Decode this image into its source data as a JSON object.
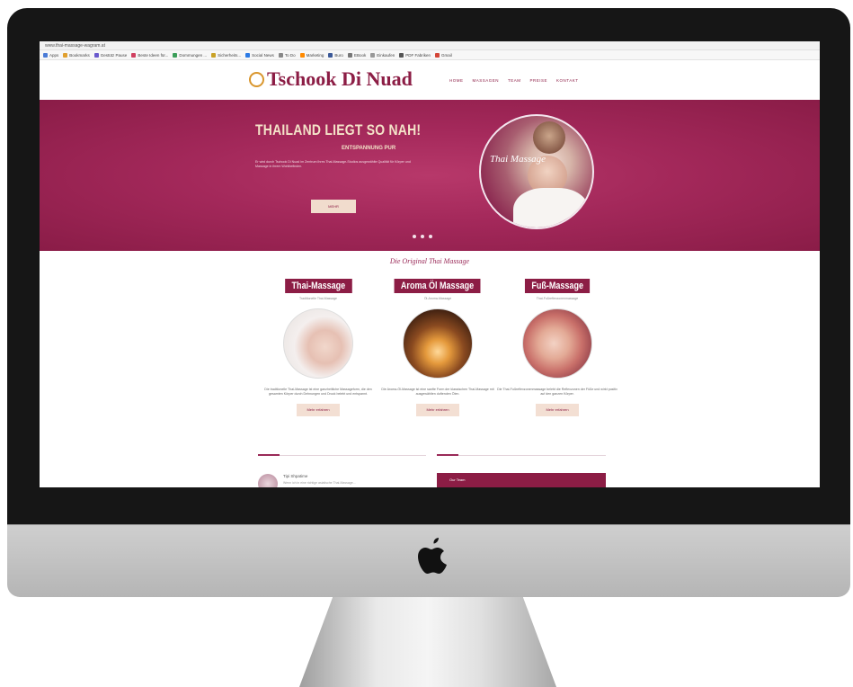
{
  "browser": {
    "url": "www.thai-massage-wagram.at",
    "bookmarks": [
      "Apps",
      "Bookmarks",
      "Gestütz Pause",
      "Beste Ideen für...",
      "Dommungen ...",
      "Sicherheits...",
      "Social News",
      "To Do",
      "Marketing",
      "Buro",
      "EBook",
      "Einkaufen",
      "PDF Fabriken",
      "Gmail"
    ]
  },
  "site": {
    "logo": "Tschook Di Nuad",
    "nav": [
      "HOME",
      "MASSAGEN",
      "TEAM",
      "PREISE",
      "KONTAKT"
    ],
    "hero": {
      "title": "THAILAND LIEGT SO NAH!",
      "subtitle": "ENTSPANNUNG PUR",
      "text": "Er wird durch Tschook Di Nuad im Zentrum Ihres Thai-Massage-Studios ausgewählte Qualität für Körper und Massage in ihrem Wohlbefinden.",
      "button": "MEHR",
      "circle_text": "Thai Massage",
      "dot_count": 3
    },
    "section_title": "Die Original Thai Massage",
    "cards": [
      {
        "label": "Thai-Massage",
        "sub": "Traditionelle Thai-Massage",
        "image": "woman-relaxing",
        "text": "Die traditionelle Thai-Massage ist eine ganzheitliche Massageform, die den gesamten Körper durch Dehnungen und Druck belebt und entspannt.",
        "button": "Mehr erfahren"
      },
      {
        "label": "Aroma Öl Massage",
        "sub": "Öl-Aroma-Massage",
        "image": "candles-and-oil",
        "text": "Die Aroma-Öl-Massage ist eine sanfte Form der klassischen Thai-Massage mit ausgewählten duftenden Ölen.",
        "button": "Mehr erfahren"
      },
      {
        "label": "Fuß-Massage",
        "sub": "Thai-Fußreflexzonenmassage",
        "image": "foot-massage",
        "text": "Die Thai-Fußreflexzonenmassage belebt die Reflexzonen der Füße und wirkt positiv auf den ganzen Körper.",
        "button": "Mehr erfahren"
      }
    ],
    "testimonial": {
      "name": "Tipi Shpatime",
      "text": "Wenn ich in eine richtige asiatische Thai-Massage..."
    },
    "widget": "Our Team"
  },
  "colors": {
    "brand": "#8c1d45",
    "hero": "#a3285a",
    "cream": "#f4e3c8",
    "logo_accent": "#d9962d"
  }
}
